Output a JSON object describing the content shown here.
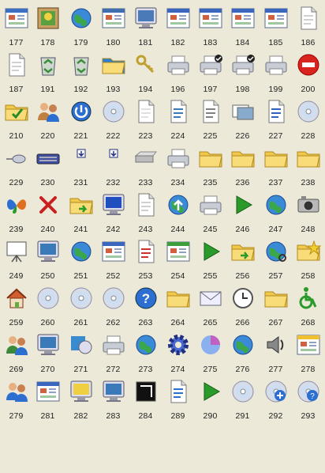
{
  "icons": [
    {
      "n": "177",
      "icon": "window-settings-icon",
      "c": "#3a6fc4"
    },
    {
      "n": "178",
      "icon": "picture-frame-icon",
      "c": "#2a8a3a"
    },
    {
      "n": "179",
      "icon": "network-computer-globe-icon",
      "c": "#1f62b8"
    },
    {
      "n": "180",
      "icon": "monitor-window-icon",
      "c": "#3d6fb0"
    },
    {
      "n": "181",
      "icon": "monitor-icon",
      "c": "#4a7ab8"
    },
    {
      "n": "182",
      "icon": "window-app-icon",
      "c": "#3a66c0"
    },
    {
      "n": "183",
      "icon": "window-app-icon",
      "c": "#3a66c0"
    },
    {
      "n": "184",
      "icon": "window-app-icon",
      "c": "#3a66c0"
    },
    {
      "n": "185",
      "icon": "window-app-icon",
      "c": "#3a66c0"
    },
    {
      "n": "186",
      "icon": "document-cursor-icon",
      "c": "#d0d0d0"
    },
    {
      "n": "187",
      "icon": "document-sparkle-icon",
      "c": "#d0d0d0"
    },
    {
      "n": "191",
      "icon": "recycle-bin-empty-icon",
      "c": "#3b8f3b"
    },
    {
      "n": "192",
      "icon": "recycle-bin-full-icon",
      "c": "#3b8f3b"
    },
    {
      "n": "193",
      "icon": "globe-folder-icon",
      "c": "#2c7fd0"
    },
    {
      "n": "194",
      "icon": "keys-icon",
      "c": "#c0a030"
    },
    {
      "n": "196",
      "icon": "scanner-icon",
      "c": "#b8c0cc"
    },
    {
      "n": "197",
      "icon": "scanner-check-icon",
      "c": "#b8c0cc"
    },
    {
      "n": "198",
      "icon": "network-scanner-check-icon",
      "c": "#b8c0cc"
    },
    {
      "n": "199",
      "icon": "network-scanner-icon",
      "c": "#b8c0cc"
    },
    {
      "n": "200",
      "icon": "no-entry-icon",
      "c": "#d8231e"
    },
    {
      "n": "210",
      "icon": "folder-check-icon",
      "c": "#f2c84b"
    },
    {
      "n": "220",
      "icon": "user-key-icon",
      "c": "#c08040"
    },
    {
      "n": "221",
      "icon": "power-icon",
      "c": "#2c6fd0"
    },
    {
      "n": "222",
      "icon": "dvd-icon",
      "c": "#c0c0c8"
    },
    {
      "n": "223",
      "icon": "documents-icon",
      "c": "#e0e0e0"
    },
    {
      "n": "224",
      "icon": "film-document-icon",
      "c": "#3a7ab8"
    },
    {
      "n": "225",
      "icon": "music-document-icon",
      "c": "#808080"
    },
    {
      "n": "226",
      "icon": "photos-icon",
      "c": "#6aa0d0"
    },
    {
      "n": "227",
      "icon": "media-document-icon",
      "c": "#3060c0"
    },
    {
      "n": "228",
      "icon": "cd-music-icon",
      "c": "#c0a020"
    },
    {
      "n": "229",
      "icon": "mouse-icon",
      "c": "#a0a8b8"
    },
    {
      "n": "230",
      "icon": "keyboard-icon",
      "c": "#4050a0"
    },
    {
      "n": "231",
      "icon": "small-arrow-down-icon",
      "c": "#203080"
    },
    {
      "n": "232",
      "icon": "small-arrow-down-icon",
      "c": "#203080"
    },
    {
      "n": "233",
      "icon": "drive-icon",
      "c": "#b8b8b8"
    },
    {
      "n": "234",
      "icon": "printer-error-icon",
      "c": "#c0c0c0"
    },
    {
      "n": "235",
      "icon": "folder-open-icon",
      "c": "#f2c84b"
    },
    {
      "n": "236",
      "icon": "folder-open-icon",
      "c": "#f2c84b"
    },
    {
      "n": "237",
      "icon": "folder-open-icon",
      "c": "#f2c84b"
    },
    {
      "n": "238",
      "icon": "folder-open-icon",
      "c": "#f2c84b"
    },
    {
      "n": "239",
      "icon": "msn-butterfly-icon",
      "c": "#e07020"
    },
    {
      "n": "240",
      "icon": "red-x-icon",
      "c": "#c82020"
    },
    {
      "n": "241",
      "icon": "folder-arrow-icon",
      "c": "#f2c84b"
    },
    {
      "n": "242",
      "icon": "monitor-resize-icon",
      "c": "#2050c0"
    },
    {
      "n": "243",
      "icon": "copy-documents-icon",
      "c": "#d0d0d0"
    },
    {
      "n": "244",
      "icon": "globe-upload-icon",
      "c": "#2c8a3a"
    },
    {
      "n": "245",
      "icon": "printer-icon",
      "c": "#c0c0c0"
    },
    {
      "n": "246",
      "icon": "play-icon",
      "c": "#2a9a2a"
    },
    {
      "n": "247",
      "icon": "globe-icon",
      "c": "#2c7fd0"
    },
    {
      "n": "248",
      "icon": "camera-icon",
      "c": "#a0a0a0"
    },
    {
      "n": "249",
      "icon": "presentation-icon",
      "c": "#e0e0e0"
    },
    {
      "n": "250",
      "icon": "monitor-pen-icon",
      "c": "#3a7ab8"
    },
    {
      "n": "251",
      "icon": "globe-window-icon",
      "c": "#2c8a3a"
    },
    {
      "n": "252",
      "icon": "window-shield-icon",
      "c": "#3a66c0"
    },
    {
      "n": "253",
      "icon": "check-document-icon",
      "c": "#d03030"
    },
    {
      "n": "254",
      "icon": "recycle-window-icon",
      "c": "#3b9f3b"
    },
    {
      "n": "255",
      "icon": "green-arrow-icon",
      "c": "#2a9a2a"
    },
    {
      "n": "256",
      "icon": "folder-arrow-open-icon",
      "c": "#f2c84b"
    },
    {
      "n": "257",
      "icon": "globe-search-icon",
      "c": "#2c7fd0"
    },
    {
      "n": "258",
      "icon": "folder-star-icon",
      "c": "#f2c84b"
    },
    {
      "n": "259",
      "icon": "home-network-icon",
      "c": "#d06030"
    },
    {
      "n": "260",
      "icon": "disc-clock-icon",
      "c": "#a0b0c8"
    },
    {
      "n": "261",
      "icon": "disc-icon",
      "c": "#b0b0b8"
    },
    {
      "n": "262",
      "icon": "disc-refresh-icon",
      "c": "#3a9a3a"
    },
    {
      "n": "263",
      "icon": "help-icon",
      "c": "#2c6fd0"
    },
    {
      "n": "264",
      "icon": "folder-icon",
      "c": "#f2c84b"
    },
    {
      "n": "265",
      "icon": "envelope-icon",
      "c": "#c0c8d8"
    },
    {
      "n": "266",
      "icon": "clock-arrow-icon",
      "c": "#3a9a3a"
    },
    {
      "n": "267",
      "icon": "folder-open-icon",
      "c": "#f2c84b"
    },
    {
      "n": "268",
      "icon": "accessibility-icon",
      "c": "#2a9a2a"
    },
    {
      "n": "269",
      "icon": "users-icon",
      "c": "#3a8a3a"
    },
    {
      "n": "270",
      "icon": "monitor-paint-icon",
      "c": "#3a7ab8"
    },
    {
      "n": "271",
      "icon": "programs-icon",
      "c": "#3a8ad0"
    },
    {
      "n": "272",
      "icon": "printer-network-icon",
      "c": "#c0c0c0"
    },
    {
      "n": "273",
      "icon": "network-globe-icon",
      "c": "#2c7fd0"
    },
    {
      "n": "274",
      "icon": "gear-icon",
      "c": "#4a6ad0"
    },
    {
      "n": "275",
      "icon": "pie-chart-icon",
      "c": "#4a6ad0"
    },
    {
      "n": "276",
      "icon": "calendar-globe-icon",
      "c": "#3a9a3a"
    },
    {
      "n": "277",
      "icon": "speaker-icon",
      "c": "#707070"
    },
    {
      "n": "278",
      "icon": "window-star-icon",
      "c": "#f0c030"
    },
    {
      "n": "279",
      "icon": "users-group-icon",
      "c": "#2c6fd0"
    },
    {
      "n": "281",
      "icon": "window-search-icon",
      "c": "#3a66c0"
    },
    {
      "n": "282",
      "icon": "lightbulb-monitor-icon",
      "c": "#f0d040"
    },
    {
      "n": "283",
      "icon": "keyboard-monitor-icon",
      "c": "#3a7ab8"
    },
    {
      "n": "284",
      "icon": "dark-frame-icon",
      "c": "#202020"
    },
    {
      "n": "289",
      "icon": "help-document-icon",
      "c": "#2c6fd0"
    },
    {
      "n": "290",
      "icon": "green-arrow-right-icon",
      "c": "#2a9a2a"
    },
    {
      "n": "291",
      "icon": "dvd-drive-icon",
      "c": "#b0b0b0"
    },
    {
      "n": "292",
      "icon": "disc-plus-icon",
      "c": "#2c6fd0"
    },
    {
      "n": "293",
      "icon": "disc-help-icon",
      "c": "#2c6fd0"
    }
  ]
}
